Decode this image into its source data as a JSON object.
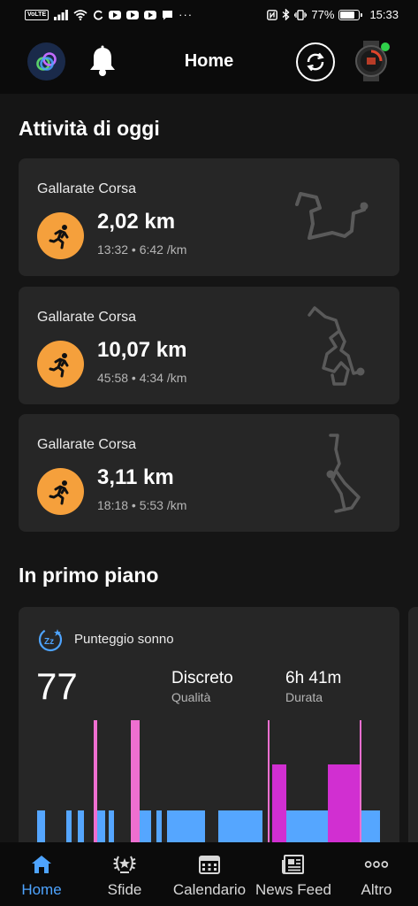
{
  "status_bar": {
    "volte": "VoLTE",
    "battery_pct": "77%",
    "battery_level": 0.77,
    "time": "15:33"
  },
  "header": {
    "title": "Home"
  },
  "today": {
    "title": "Attività di oggi",
    "activities": [
      {
        "name": "Gallarate Corsa",
        "distance": "2,02 km",
        "meta": "13:32 • 6:42 /km"
      },
      {
        "name": "Gallarate Corsa",
        "distance": "10,07 km",
        "meta": "45:58 • 4:34 /km"
      },
      {
        "name": "Gallarate Corsa",
        "distance": "3,11 km",
        "meta": "18:18 • 5:53 /km"
      }
    ]
  },
  "highlights": {
    "title": "In primo piano",
    "sleep": {
      "title": "Punteggio sonno",
      "score": "77",
      "quality_value": "Discreto",
      "quality_label": "Qualità",
      "duration_value": "6h 41m",
      "duration_label": "Durata"
    }
  },
  "colors": {
    "accent": "#4ea4ff",
    "activity": "#f5a03c",
    "sleep_light": "#55a6ff",
    "sleep_deep": "#d12fd1",
    "sleep_awake": "#ee6fd0",
    "online": "#2fd04a"
  },
  "nav": [
    {
      "label": "Home",
      "icon": "home-icon",
      "active": true
    },
    {
      "label": "Sfide",
      "icon": "laurel-icon",
      "active": false
    },
    {
      "label": "Calendario",
      "icon": "calendar-icon",
      "active": false
    },
    {
      "label": "News Feed",
      "icon": "newspaper-icon",
      "active": false
    },
    {
      "label": "Altro",
      "icon": "more-icon",
      "active": false
    }
  ]
}
